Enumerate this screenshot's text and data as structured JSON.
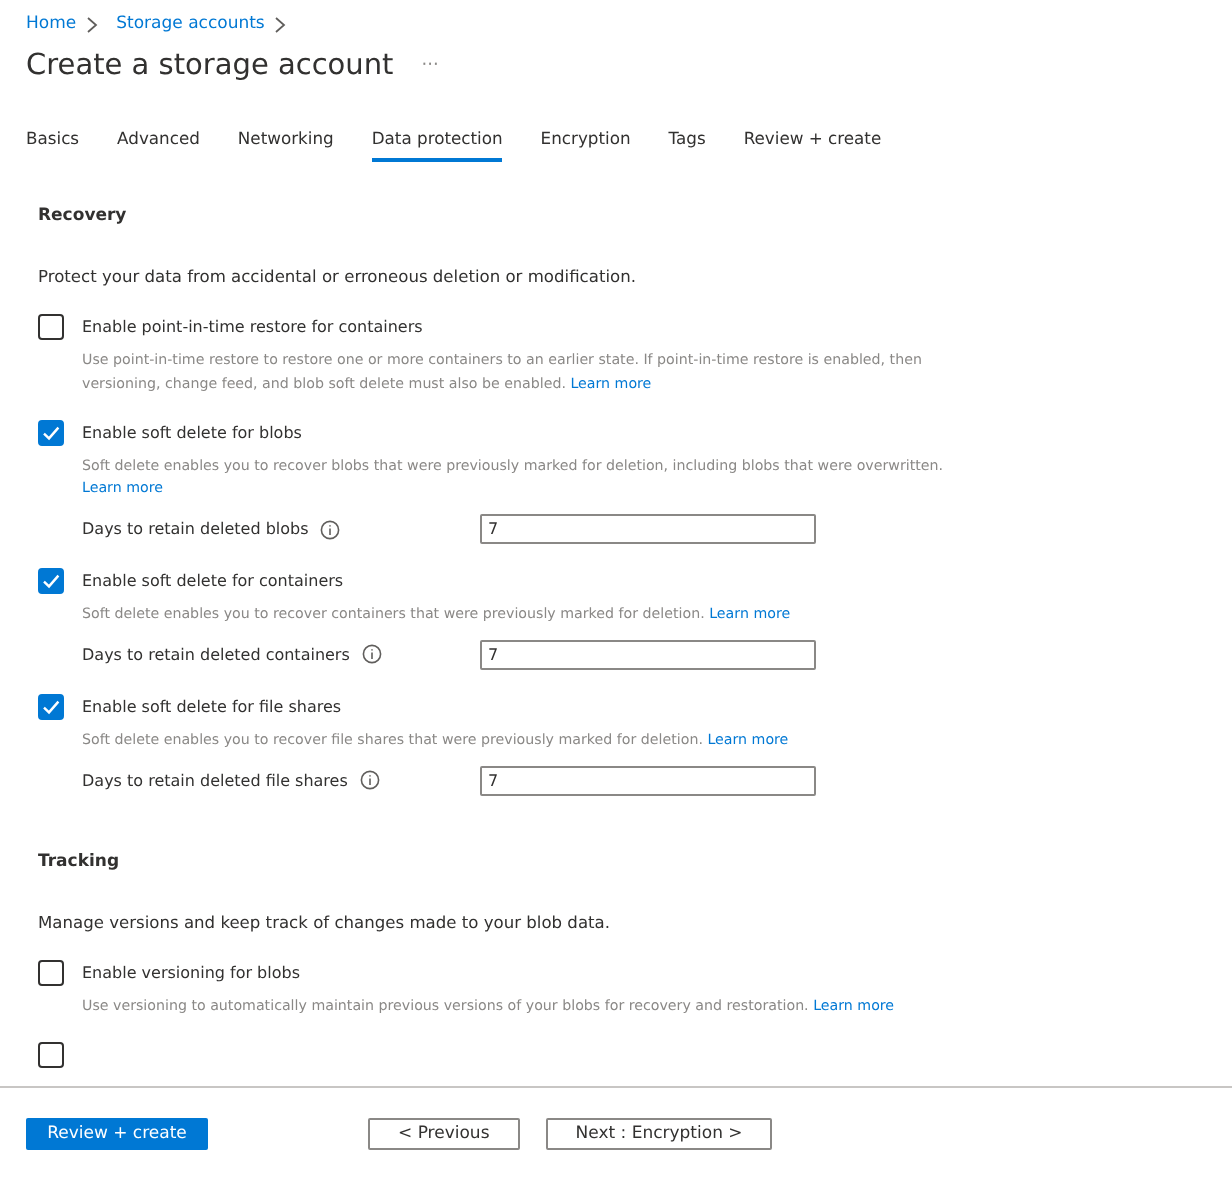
{
  "breadcrumb": [
    "Home",
    "Storage accounts"
  ],
  "title": "Create a storage account",
  "more": "···",
  "tabs": [
    {
      "label": "Basics",
      "selected": false
    },
    {
      "label": "Advanced",
      "selected": false
    },
    {
      "label": "Networking",
      "selected": false
    },
    {
      "label": "Data protection",
      "selected": true
    },
    {
      "label": "Encryption",
      "selected": false
    },
    {
      "label": "Tags",
      "selected": false
    },
    {
      "label": "Review + create",
      "selected": false
    }
  ],
  "sections": [
    {
      "title": "Recovery",
      "description": "Protect your data from accidental or erroneous deletion or modification.",
      "options": [
        {
          "label": "Enable point-in-time restore for containers",
          "checked": false,
          "description": "Use point-in-time restore to restore one or more containers to an earlier state. If point-in-time restore is enabled, then versioning, change feed, and blob soft delete must also be enabled.",
          "link": "Learn more"
        },
        {
          "label": "Enable soft delete for blobs",
          "checked": true,
          "description": "Soft delete enables you to recover blobs that were previously marked for deletion, including blobs that were overwritten.",
          "link": "Learn more",
          "retain": {
            "label": "Days to retain deleted blobs",
            "value": "7"
          }
        },
        {
          "label": "Enable soft delete for containers",
          "checked": true,
          "description": "Soft delete enables you to recover containers that were previously marked for deletion.",
          "link": "Learn more",
          "retain": {
            "label": "Days to retain deleted containers",
            "value": "7"
          }
        },
        {
          "label": "Enable soft delete for file shares",
          "checked": true,
          "description": "Soft delete enables you to recover file shares that were previously marked for deletion.",
          "link": "Learn more",
          "retain": {
            "label": "Days to retain deleted file shares",
            "value": "7"
          }
        }
      ]
    },
    {
      "title": "Tracking",
      "description": "Manage versions and keep track of changes made to your blob data.",
      "options": [
        {
          "label": "Enable versioning for blobs",
          "checked": false,
          "description": "Use versioning to automatically maintain previous versions of your blobs for recovery and restoration.",
          "link": "Learn more"
        },
        {
          "checked": false
        }
      ]
    }
  ],
  "footer": {
    "primary": "Review + create",
    "previous": "< Previous",
    "next": "Next : Encryption >"
  }
}
